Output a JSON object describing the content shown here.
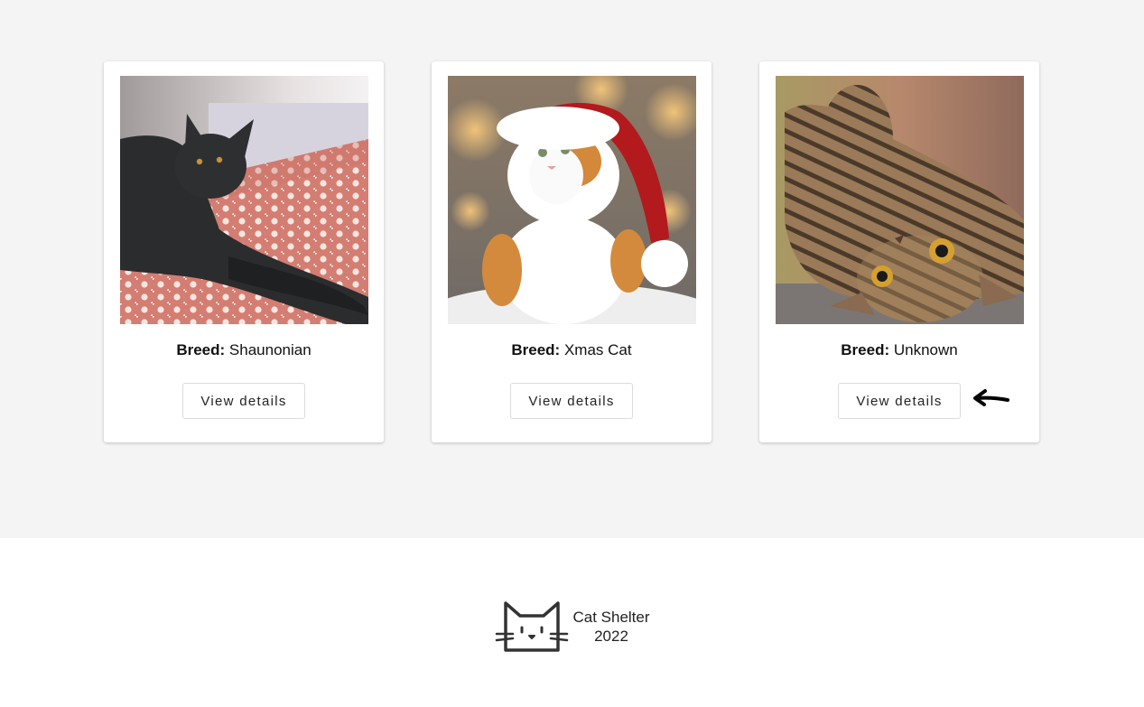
{
  "cats": [
    {
      "breed_label": "Breed:",
      "breed_value": "Shaunonian",
      "button_label": "View details"
    },
    {
      "breed_label": "Breed:",
      "breed_value": "Xmas Cat",
      "button_label": "View details"
    },
    {
      "breed_label": "Breed:",
      "breed_value": "Unknown",
      "button_label": "View details"
    }
  ],
  "footer": {
    "brand_name": "Cat Shelter",
    "year": "2022",
    "logo_icon": "cat-face-icon"
  },
  "pointer_icon": "left-arrow-pointer-icon",
  "colors": {
    "page_background": "#f4f4f4",
    "card_background": "#ffffff",
    "footer_background": "#ffffff"
  }
}
